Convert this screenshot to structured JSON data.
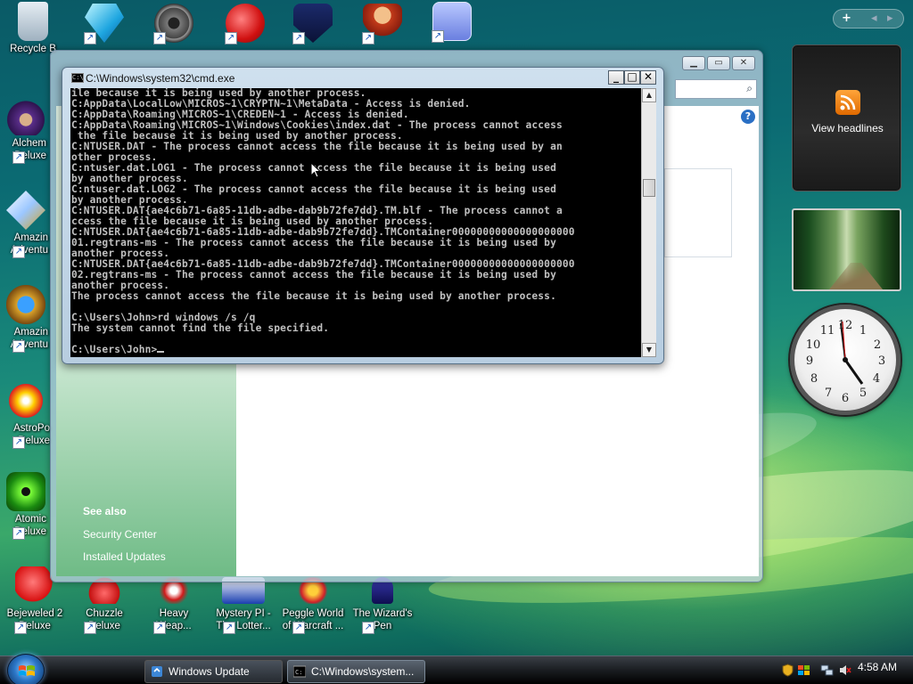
{
  "desktop": {
    "icons": [
      {
        "label": "Recycle Bin",
        "short": "Recycle B"
      },
      {
        "label": "",
        "short": ""
      },
      {
        "label": "",
        "short": ""
      },
      {
        "label": "",
        "short": ""
      },
      {
        "label": "",
        "short": ""
      },
      {
        "label": "",
        "short": ""
      },
      {
        "label": "",
        "short": ""
      },
      {
        "label": "Alchemy Deluxe",
        "short": "Alchem\nDeluxe"
      },
      {
        "label": "Amazing Adventures",
        "short": "Amazin\nAdventu"
      },
      {
        "label": "Amazing Adventures",
        "short": "Amazin\nAdventu"
      },
      {
        "label": "AstroPop Deluxe",
        "short": "AstroPo\nDeluxe"
      },
      {
        "label": "Atomic Deluxe",
        "short": "Atomic\nDeluxe"
      },
      {
        "label": "Bejeweled 2 Deluxe",
        "short": "Bejeweled 2\nDeluxe"
      },
      {
        "label": "Chuzzle Deluxe",
        "short": "Chuzzle\nDeluxe"
      },
      {
        "label": "Heavy Weapon",
        "short": "Heavy\nWeap..."
      },
      {
        "label": "Mystery P.I. - The Lottery",
        "short": "Mystery PI -\nThe Lotter..."
      },
      {
        "label": "Peggle World of Warcraft",
        "short": "Peggle World\nof Warcraft ..."
      },
      {
        "label": "The Wizard's Pen",
        "short": "The Wizard's\nPen"
      }
    ]
  },
  "sidebar": {
    "feed_label": "View headlines",
    "add_glyph": "+",
    "prev_glyph": "◂",
    "next_glyph": "▸"
  },
  "windows_update": {
    "title": "Windows Update",
    "see_also": "See also",
    "links": [
      "Security Center",
      "Installed Updates"
    ],
    "help": "?"
  },
  "cmd": {
    "title": "C:\\Windows\\system32\\cmd.exe",
    "icon_text": "C:\\",
    "lines": [
      "ile because it is being used by another process.",
      "C:AppData\\LocalLow\\MICROS~1\\CRYPTN~1\\MetaData - Access is denied.",
      "C:AppData\\Roaming\\MICROS~1\\CREDEN~1 - Access is denied.",
      "C:AppData\\Roaming\\MICROS~1\\Windows\\Cookies\\index.dat - The process cannot access",
      " the file because it is being used by another process.",
      "C:NTUSER.DAT - The process cannot access the file because it is being used by an",
      "other process.",
      "C:ntuser.dat.LOG1 - The process cannot access the file because it is being used",
      "by another process.",
      "C:ntuser.dat.LOG2 - The process cannot access the file because it is being used",
      "by another process.",
      "C:NTUSER.DAT{ae4c6b71-6a85-11db-adbe-dab9b72fe7dd}.TM.blf - The process cannot a",
      "ccess the file because it is being used by another process.",
      "C:NTUSER.DAT{ae4c6b71-6a85-11db-adbe-dab9b72fe7dd}.TMContainer00000000000000000000",
      "01.regtrans-ms - The process cannot access the file because it is being used by",
      "another process.",
      "C:NTUSER.DAT{ae4c6b71-6a85-11db-adbe-dab9b72fe7dd}.TMContainer00000000000000000000",
      "02.regtrans-ms - The process cannot access the file because it is being used by",
      "another process.",
      "The process cannot access the file because it is being used by another process.",
      "",
      "C:\\Users\\John>rd windows /s /q",
      "The system cannot find the file specified.",
      "",
      "C:\\Users\\John>"
    ],
    "scroll_up": "▲",
    "scroll_down": "▼"
  },
  "taskbar": {
    "buttons": [
      {
        "label": "Windows Update"
      },
      {
        "label": "C:\\Windows\\system..."
      }
    ],
    "time": "4:58 AM"
  },
  "colors": {
    "console_bg": "#000000",
    "console_fg": "#c0c0c0",
    "feed_orange": "#f28b12"
  }
}
